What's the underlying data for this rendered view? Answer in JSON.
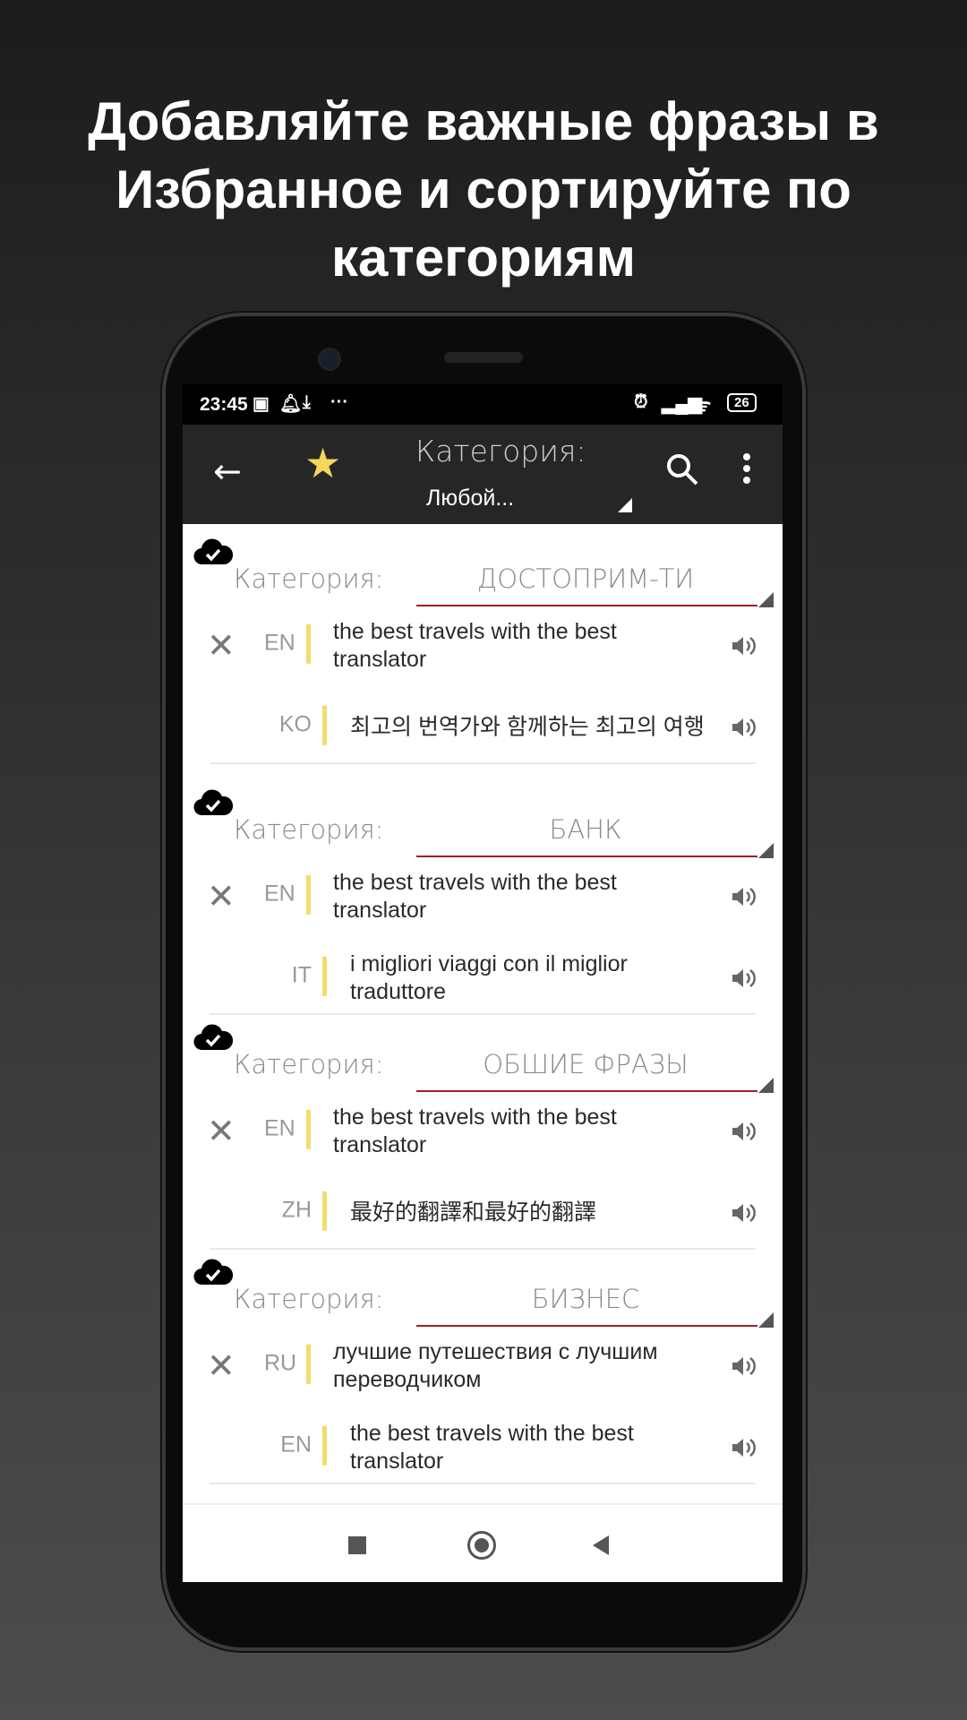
{
  "headline": [
    "Добавляйте важные фразы в",
    "Избранное и сортируйте по",
    "категориям"
  ],
  "status": {
    "time": "23:45",
    "battery": "26",
    "icons": [
      "game-icon",
      "bell-icon",
      "download-icon",
      "more-dots-icon",
      "alarm-icon",
      "signal-icon",
      "wifi-icon",
      "battery-icon"
    ]
  },
  "toolbar": {
    "label": "Категория:",
    "value": "Любой...",
    "star_color": "#f6d55c"
  },
  "sections": [
    {
      "category_label": "Категория:",
      "category": "ДОСТОПРИМ-ТИ",
      "rows": [
        {
          "lang": "EN",
          "text": "the best travels with the best translator"
        },
        {
          "lang": "KO",
          "text": "최고의 번역가와 함께하는 최고의 여행"
        }
      ]
    },
    {
      "category_label": "Категория:",
      "category": "БАНК",
      "rows": [
        {
          "lang": "EN",
          "text": "the best travels with the best translator"
        },
        {
          "lang": "IT",
          "text": "i migliori viaggi con il miglior traduttore"
        }
      ]
    },
    {
      "category_label": "Категория:",
      "category": "ОБШИЕ ФРАЗЫ",
      "rows": [
        {
          "lang": "EN",
          "text": "the best travels with the best translator"
        },
        {
          "lang": "ZH",
          "text": "最好的翻譯和最好的翻譯"
        }
      ]
    },
    {
      "category_label": "Категория:",
      "category": "БИЗНЕС",
      "rows": [
        {
          "lang": "RU",
          "text": "лучшие путешествия с лучшим переводчиком"
        },
        {
          "lang": "EN",
          "text": "the best travels with the best translator"
        }
      ]
    }
  ],
  "colors": {
    "accent_line": "#a31f1f",
    "lang_bar": "#f3dc6b",
    "toolbar": "#262626"
  }
}
